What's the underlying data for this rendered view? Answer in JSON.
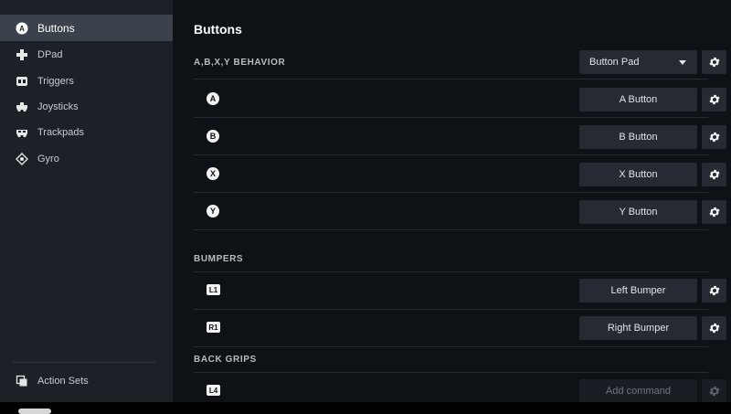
{
  "sidebar": {
    "items": [
      {
        "label": "Buttons",
        "icon": "a-button-icon",
        "active": true
      },
      {
        "label": "DPad",
        "icon": "dpad-icon"
      },
      {
        "label": "Triggers",
        "icon": "trigger-icon"
      },
      {
        "label": "Joysticks",
        "icon": "joystick-icon"
      },
      {
        "label": "Trackpads",
        "icon": "trackpad-icon"
      },
      {
        "label": "Gyro",
        "icon": "gyro-icon"
      }
    ],
    "footer": {
      "label": "Action Sets",
      "icon": "action-sets-icon"
    }
  },
  "main": {
    "title": "Buttons",
    "sections": {
      "abxy": {
        "header": "A,B,X,Y BEHAVIOR",
        "dropdown_value": "Button Pad",
        "rows": [
          {
            "glyph": "A",
            "command": "A Button"
          },
          {
            "glyph": "B",
            "command": "B Button"
          },
          {
            "glyph": "X",
            "command": "X Button"
          },
          {
            "glyph": "Y",
            "command": "Y Button"
          }
        ]
      },
      "bumpers": {
        "header": "BUMPERS",
        "rows": [
          {
            "glyph": "L1",
            "command": "Left Bumper"
          },
          {
            "glyph": "R1",
            "command": "Right Bumper"
          }
        ]
      },
      "back_grips": {
        "header": "BACK GRIPS",
        "rows": [
          {
            "glyph": "L4",
            "command": "Add command"
          }
        ]
      }
    }
  },
  "colors": {
    "sidebar_bg": "#1c2027",
    "sidebar_active": "#3b424c",
    "main_bg": "#0e1115",
    "button_bg": "#262b33",
    "text": "#dfe3e6"
  }
}
